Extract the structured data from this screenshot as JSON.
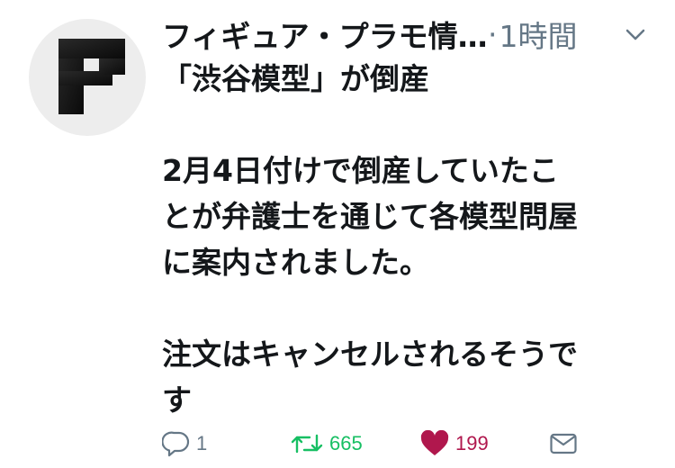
{
  "tweet": {
    "author_name": "フィギュア・プラモ情…",
    "separator": "·",
    "timestamp": "1時間",
    "avatar_icon": "brand-logo-f-icon",
    "menu_icon": "chevron-down-icon",
    "text_lines": [
      "「渋谷模型」が倒産",
      "",
      "2月4日付けで倒産していたこ",
      "とが弁護士を通じて各模型問屋",
      "に案内されました。",
      "",
      "注文はキャンセルされるそうで",
      "す"
    ]
  },
  "actions": {
    "reply": {
      "icon": "reply-icon",
      "count": "1"
    },
    "retweet": {
      "icon": "retweet-icon",
      "count": "665",
      "color": "#17bf63"
    },
    "like": {
      "icon": "heart-icon",
      "count": "199",
      "color": "#b0174d"
    },
    "message": {
      "icon": "envelope-icon"
    }
  }
}
